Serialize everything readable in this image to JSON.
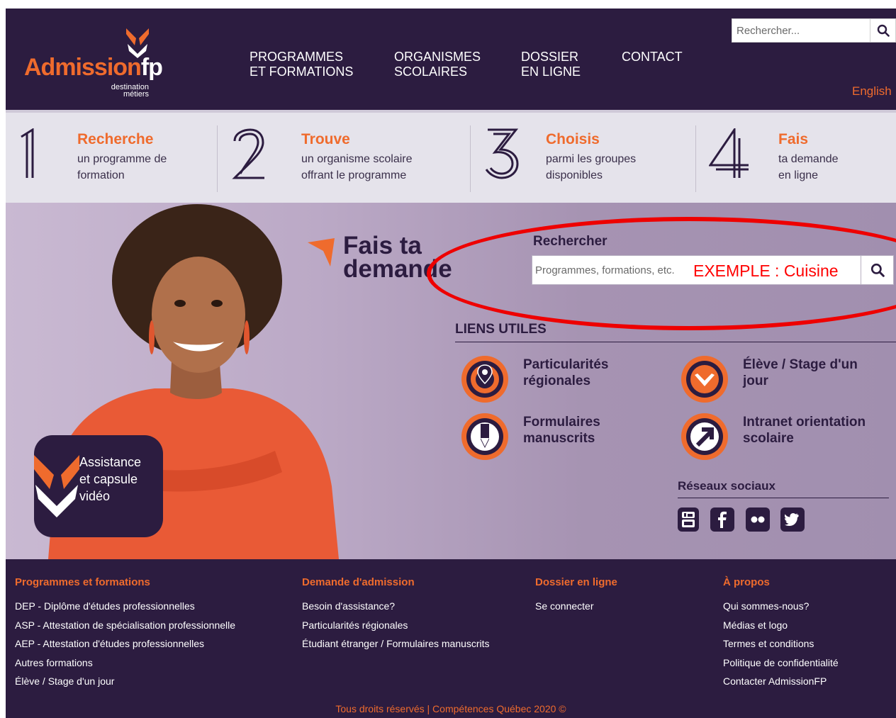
{
  "header": {
    "logo_word": "Admission",
    "logo_fp": "fp",
    "logo_sub_1": "destination",
    "logo_sub_2": "métiers",
    "nav": [
      {
        "label": "PROGRAMMES\nET FORMATIONS"
      },
      {
        "label": "ORGANISMES\nSCOLAIRES"
      },
      {
        "label": "DOSSIER\nEN LIGNE"
      },
      {
        "label": "CONTACT"
      }
    ],
    "search_placeholder": "Rechercher...",
    "language": "English"
  },
  "steps": [
    {
      "number": "1",
      "title": "Recherche",
      "desc": "un programme de\nformation"
    },
    {
      "number": "2",
      "title": "Trouve",
      "desc": "un organisme scolaire\noffrant le programme"
    },
    {
      "number": "3",
      "title": "Choisis",
      "desc": "parmi les groupes\ndisponibles"
    },
    {
      "number": "4",
      "title": "Fais",
      "desc": "ta demande\nen ligne"
    }
  ],
  "hero": {
    "headline": "Fais ta\ndemande",
    "search_label": "Rechercher",
    "search_placeholder": "Programmes, formations, etc.",
    "example_annotation": "EXEMPLE : Cuisine",
    "assist_label": "Assistance\net capsule\nvidéo",
    "links_title": "LIENS UTILES",
    "links": [
      {
        "label": "Particularités\nrégionales",
        "icon": "map-pin-icon"
      },
      {
        "label": "Élève / Stage d'un\njour",
        "icon": "heart-check-icon"
      },
      {
        "label": "Formulaires\nmanuscrits",
        "icon": "pencil-icon"
      },
      {
        "label": "Intranet orientation\nscolaire",
        "icon": "arrow-icon"
      }
    ],
    "social_title": "Réseaux sociaux",
    "social": [
      "youtube-icon",
      "facebook-icon",
      "flickr-icon",
      "twitter-icon"
    ]
  },
  "footer": {
    "columns": [
      {
        "title": "Programmes et formations",
        "links": [
          "DEP - Diplôme d'études professionnelles",
          "ASP - Attestation de spécialisation professionnelle",
          "AEP - Attestation d'études professionnelles",
          "Autres formations",
          "Élève / Stage d'un jour"
        ]
      },
      {
        "title": "Demande d'admission",
        "links": [
          "Besoin d'assistance?",
          "Particularités régionales",
          "Étudiant étranger / Formulaires manuscrits"
        ]
      },
      {
        "title": "Dossier en ligne",
        "links": [
          "Se connecter"
        ]
      },
      {
        "title": "À propos",
        "links": [
          "Qui sommes-nous?",
          "Médias et logo",
          "Termes et conditions",
          "Politique de confidentialité",
          "Contacter AdmissionFP"
        ]
      }
    ],
    "copyright": "Tous droits réservés | Compétences Québec 2020 ©"
  },
  "colors": {
    "brand_dark": "#2c1c40",
    "accent": "#ef6b2d",
    "annotation": "#ff0000"
  }
}
